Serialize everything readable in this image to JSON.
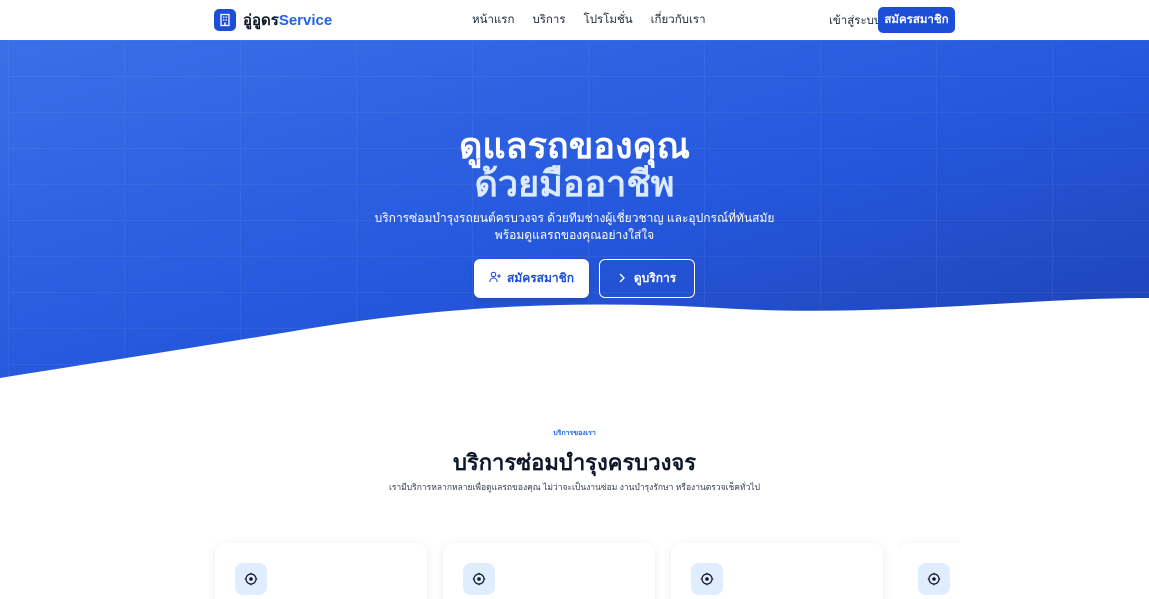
{
  "nav": {
    "brand_thai": "อู่อูดร",
    "brand_en": "Service",
    "links": [
      "หน้าแรก",
      "บริการ",
      "โปรโมชั่น",
      "เกี่ยวกับเรา"
    ],
    "login": "เข้าสู่ระบบ",
    "register": "สมัครสมาชิก"
  },
  "hero": {
    "title_line1": "ดูแลรถของคุณ",
    "title_line2": "ด้วยมืออาชีพ",
    "subtitle_line1": "บริการซ่อมบำรุงรถยนต์ครบวงจร ด้วยทีมช่างผู้เชี่ยวชาญ และอุปกรณ์ที่ทันสมัย",
    "subtitle_line2": "พร้อมดูแลรถของคุณอย่างใส่ใจ",
    "primary_button": "สมัครสมาชิก",
    "secondary_button": "ดูบริการ"
  },
  "services": {
    "eyebrow": "บริการของเรา",
    "title": "บริการซ่อมบำรุงครบวงจร",
    "subtitle": "เรามีบริการหลากหลายเพื่อดูแลรถของคุณ ไม่ว่าจะเป็นงานซ่อม งานบำรุงรักษา หรืองานตรวจเช็คทั่วไป",
    "card_icons": [
      "gear-icon",
      "gear-icon",
      "gear-icon",
      "gear-icon"
    ]
  },
  "colors": {
    "primary": "#1d4ed8",
    "hero_gradient_start": "#3b6fe8",
    "hero_gradient_end": "#1e40af",
    "card_icon_bg": "#e0ecff"
  }
}
